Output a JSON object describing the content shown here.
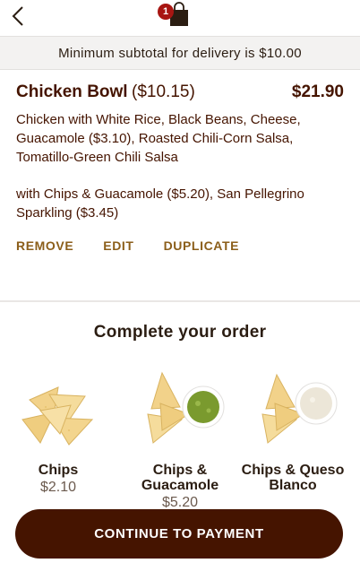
{
  "header": {
    "back_icon": "chevron-left-icon",
    "bag_icon": "shopping-bag-icon",
    "bag_count": "1"
  },
  "banner": {
    "text": "Minimum subtotal for delivery is $10.00"
  },
  "cart_item": {
    "name": "Chicken Bowl",
    "base_price": "($10.15)",
    "total": "$21.90",
    "description": "Chicken with White Rice, Black Beans, Cheese, Guacamole ($3.10), Roasted Chili-Corn Salsa, Tomatillo-Green Chili Salsa",
    "extras": "with Chips & Guacamole ($5.20), San Pellegrino Sparkling  ($3.45)",
    "actions": {
      "remove": "REMOVE",
      "edit": "EDIT",
      "duplicate": "DUPLICATE"
    }
  },
  "upsell": {
    "title": "Complete your order",
    "items": [
      {
        "name": "Chips",
        "price": "$2.10",
        "image": "chips"
      },
      {
        "name": "Chips & Guacamole",
        "price": "$5.20",
        "image": "chips-guacamole"
      },
      {
        "name": "Chips & Queso Blanco",
        "price": "",
        "image": "chips-queso"
      }
    ]
  },
  "cta": {
    "label": "CONTINUE TO PAYMENT"
  },
  "colors": {
    "brand_brown": "#451400",
    "action_gold": "#8b5e1a",
    "badge_red": "#a81612",
    "banner_bg": "#f3f2f1"
  }
}
